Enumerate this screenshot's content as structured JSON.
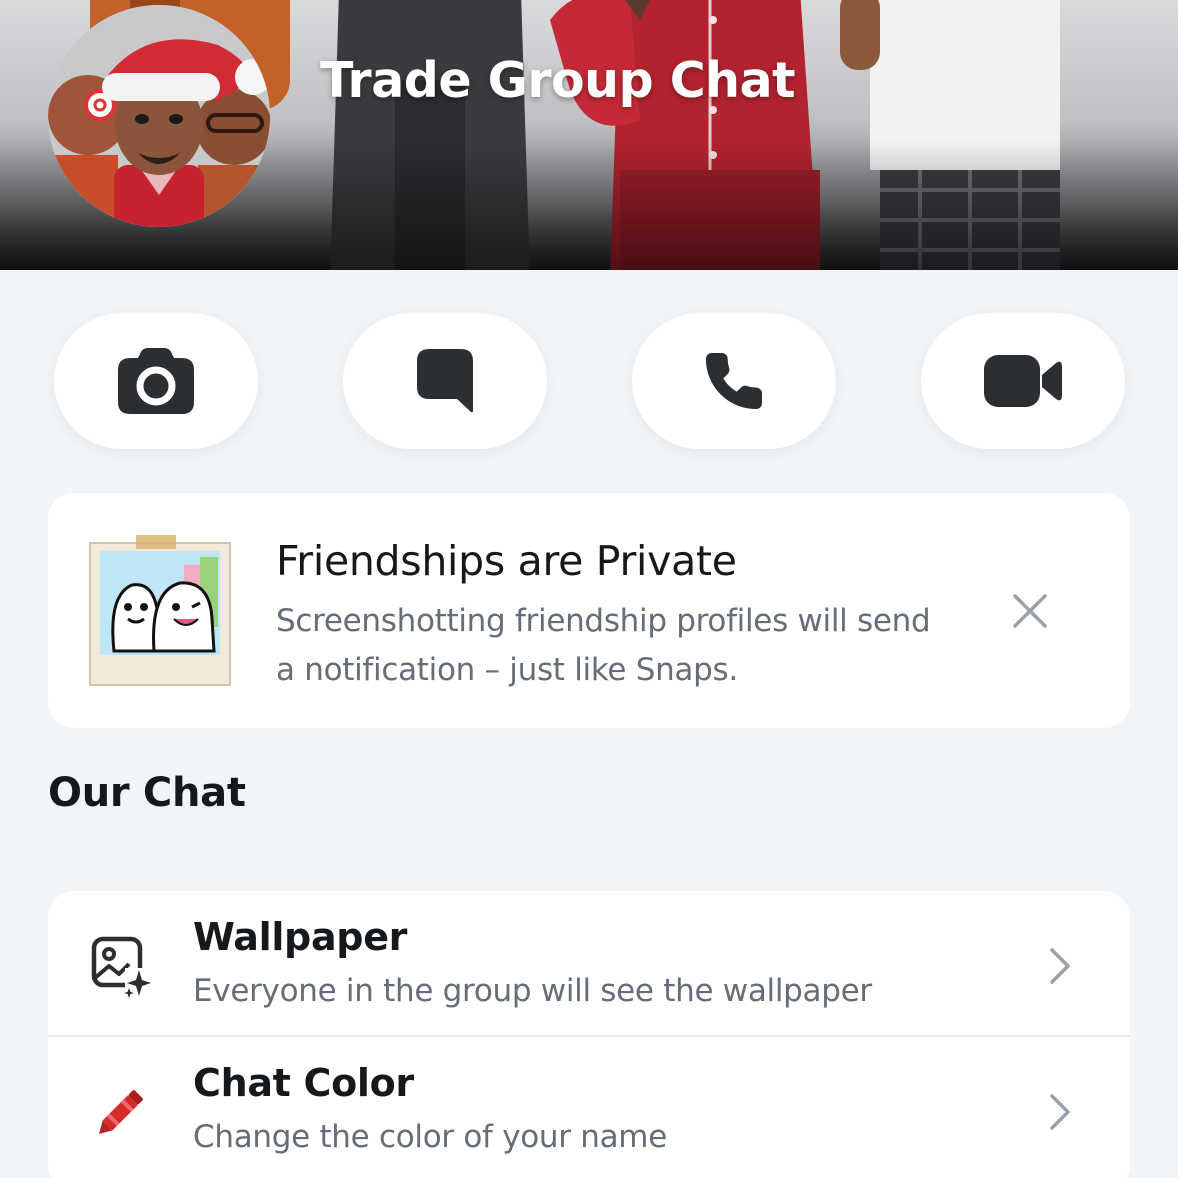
{
  "header": {
    "title": "Trade Group Chat"
  },
  "actions": [
    {
      "icon": "camera-icon"
    },
    {
      "icon": "chat-bubble-icon"
    },
    {
      "icon": "phone-icon"
    },
    {
      "icon": "video-camera-icon"
    }
  ],
  "privacy_card": {
    "title": "Friendships are Private",
    "body": "Screenshotting friendship profiles will send a notification – just like Snaps.",
    "close_icon": "close-icon"
  },
  "section": {
    "heading": "Our Chat"
  },
  "settings": [
    {
      "title": "Wallpaper",
      "subtitle": "Everyone in the group will see the wallpaper",
      "icon": "wallpaper-icon"
    },
    {
      "title": "Chat Color",
      "subtitle": "Change the color of your name",
      "icon": "crayon-icon"
    }
  ],
  "colors": {
    "background": "#F2F5F7",
    "card": "#FFFFFF",
    "icon_dark": "#2B2E33",
    "text_primary": "#16191C",
    "text_secondary": "#656D78",
    "crayon_red": "#D62B2B"
  }
}
